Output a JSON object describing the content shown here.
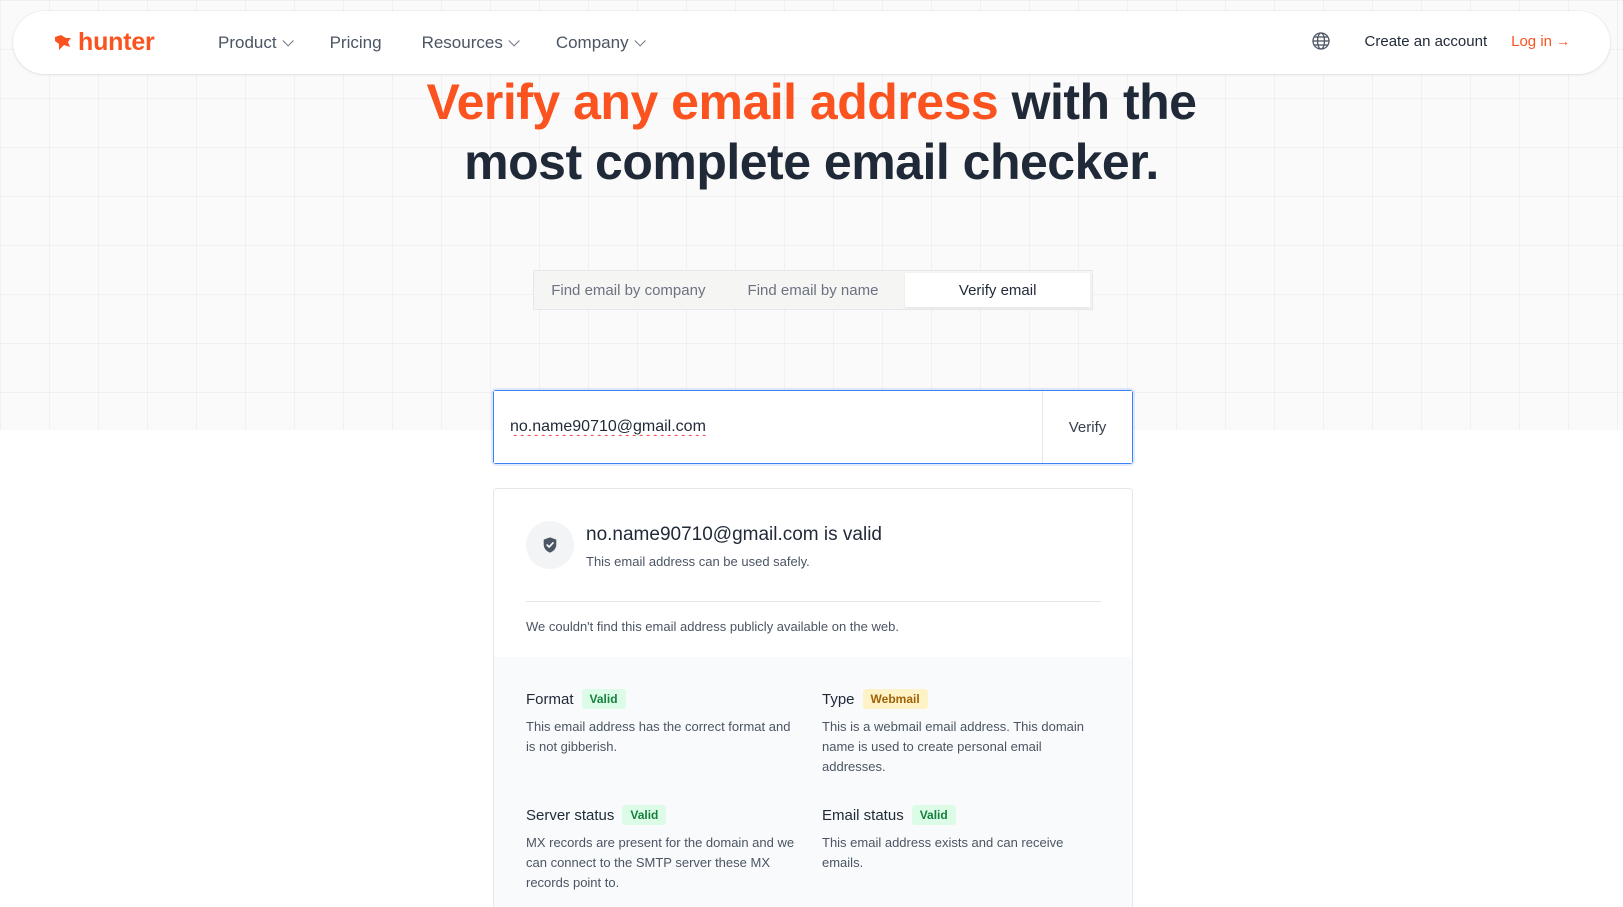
{
  "brand": {
    "name": "hunter",
    "color": "#fa5320"
  },
  "nav": {
    "items": [
      {
        "label": "Product",
        "has_dropdown": true
      },
      {
        "label": "Pricing",
        "has_dropdown": false
      },
      {
        "label": "Resources",
        "has_dropdown": true
      },
      {
        "label": "Company",
        "has_dropdown": true
      }
    ],
    "globe_icon": "globe-icon",
    "create_account": "Create an account",
    "login": "Log in",
    "login_arrow": "→"
  },
  "hero": {
    "accent": "Verify any email address",
    "rest_line1": " with the",
    "line2": "most complete email checker."
  },
  "tabs": [
    {
      "label": "Find email by company",
      "active": false
    },
    {
      "label": "Find email by name",
      "active": false
    },
    {
      "label": "Verify email",
      "active": true
    }
  ],
  "search": {
    "value": "no.name90710@gmail.com",
    "button": "Verify"
  },
  "result": {
    "title": "no.name90710@gmail.com is valid",
    "subtitle": "This email address can be used safely.",
    "note": "We couldn't find this email address publicly available on the web.",
    "details": [
      {
        "label": "Format",
        "badge": "Valid",
        "badge_color": "green",
        "desc": "This email address has the correct format and is not gibberish."
      },
      {
        "label": "Type",
        "badge": "Webmail",
        "badge_color": "yellow",
        "desc": "This is a webmail email address. This domain name is used to create personal email addresses."
      },
      {
        "label": "Server status",
        "badge": "Valid",
        "badge_color": "green",
        "desc": "MX records are present for the domain and we can connect to the SMTP server these MX records point to."
      },
      {
        "label": "Email status",
        "badge": "Valid",
        "badge_color": "green",
        "desc": "This email address exists and can receive emails."
      }
    ]
  }
}
